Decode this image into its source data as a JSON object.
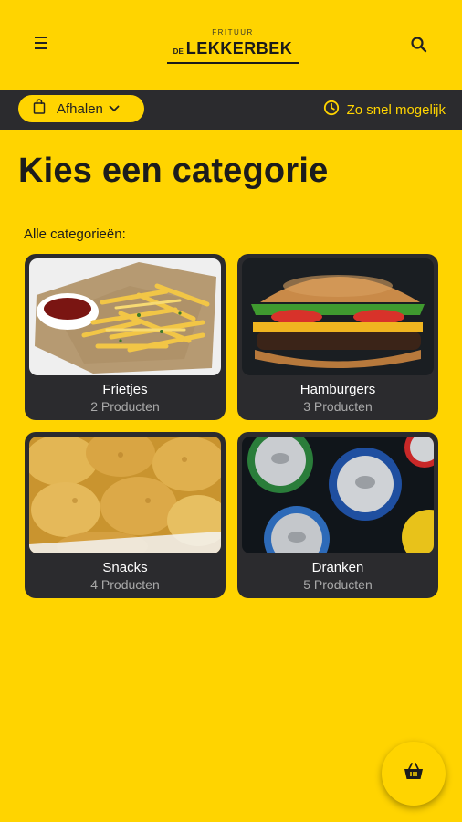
{
  "header": {
    "logo_small": "FRITUUR",
    "logo_prefix": "DE",
    "logo_main": "LEKKERBEK",
    "menu_icon": "hamburger-menu-icon",
    "search_icon": "search-icon"
  },
  "orderbar": {
    "pickup_label": "Afhalen",
    "pickup_icon": "shopping-bag-icon",
    "time_label": "Zo snel mogelijk",
    "time_icon": "clock-icon"
  },
  "main": {
    "title": "Kies een categorie",
    "section_label": "Alle categorieën:",
    "categories": [
      {
        "name": "Frietjes",
        "count": "2 Producten"
      },
      {
        "name": "Hamburgers",
        "count": "3 Producten"
      },
      {
        "name": "Snacks",
        "count": "4 Producten"
      },
      {
        "name": "Dranken",
        "count": "5 Producten"
      }
    ]
  },
  "cart": {
    "icon": "basket-icon"
  },
  "colors": {
    "brand_yellow": "#FFD400",
    "dark": "#2b2b2e"
  }
}
